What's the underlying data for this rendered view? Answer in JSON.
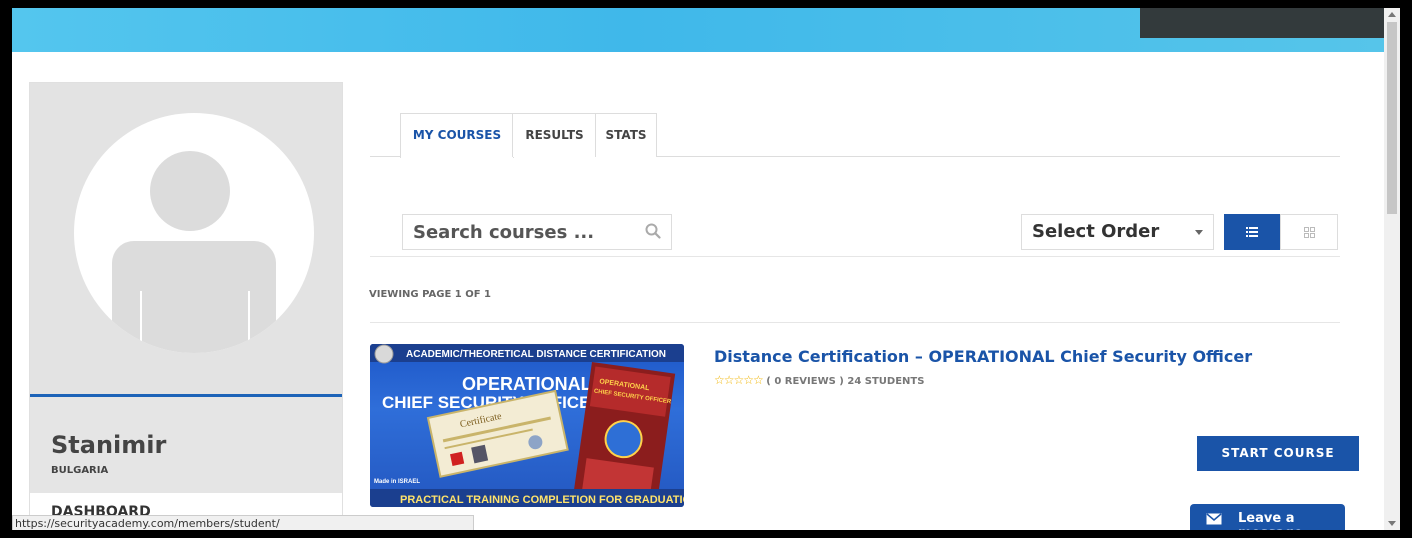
{
  "profile": {
    "name": "Stanimir",
    "country": "BULGARIA",
    "menu_dashboard": "DASHBOARD"
  },
  "tabs": [
    {
      "label": "MY COURSES",
      "active": true
    },
    {
      "label": "RESULTS",
      "active": false
    },
    {
      "label": "STATS",
      "active": false
    }
  ],
  "search": {
    "placeholder": "Search courses ..."
  },
  "order_select": {
    "selected": "Select Order"
  },
  "paging": {
    "label": "VIEWING PAGE 1 OF 1"
  },
  "course": {
    "thumb_top": "ACADEMIC/THEORETICAL DISTANCE CERTIFICATION",
    "thumb_title": "OPERATIONAL",
    "thumb_title2": "CHIEF SECURITY OFFICER",
    "thumb_bottom": "PRACTICAL TRAINING COMPLETION FOR GRADUATION",
    "thumb_made": "Made in ISRAEL",
    "thumb_certificate": "Certificate",
    "title": "Distance Certification – OPERATIONAL Chief Security Officer",
    "stars": "☆☆☆☆☆",
    "reviews": "( 0 REVIEWS )",
    "students": "24 STUDENTS",
    "start_label": "START COURSE"
  },
  "status_url": "https://securityacademy.com/members/student/",
  "chat": {
    "label": "Leave a message"
  },
  "colors": {
    "brand_blue": "#1a54a8",
    "topbar_blue": "#54c6ee"
  }
}
